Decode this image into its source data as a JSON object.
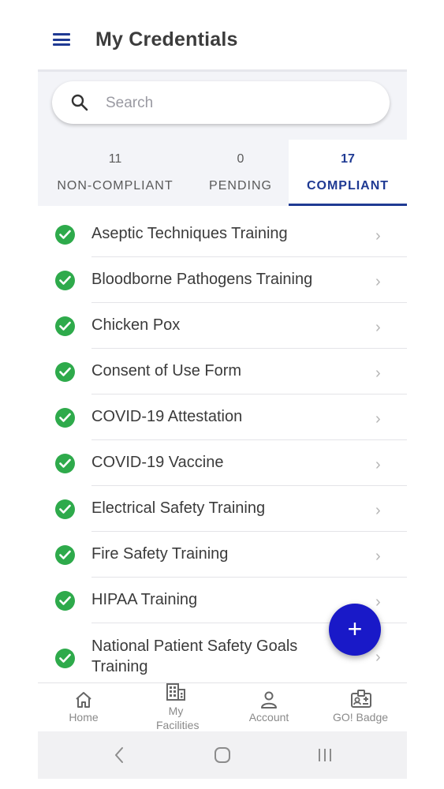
{
  "header": {
    "title": "My Credentials"
  },
  "search": {
    "placeholder": "Search"
  },
  "tabs": [
    {
      "count": "11",
      "label": "NON-COMPLIANT",
      "active": false
    },
    {
      "count": "0",
      "label": "PENDING",
      "active": false
    },
    {
      "count": "17",
      "label": "COMPLIANT",
      "active": true
    }
  ],
  "credentials": [
    "Aseptic Techniques Training",
    "Bloodborne Pathogens Training",
    "Chicken Pox",
    "Consent of Use Form",
    "COVID-19 Attestation",
    "COVID-19 Vaccine",
    "Electrical Safety Training",
    "Fire Safety Training",
    "HIPAA Training",
    "National Patient Safety Goals Training"
  ],
  "bottom_nav": {
    "home": "Home",
    "facilities": "My Facilities",
    "account": "Account",
    "badge": "GO! Badge"
  },
  "colors": {
    "accent": "#1f3a93",
    "status_ok": "#2eaa4b",
    "fab": "#1919c8"
  },
  "icons": [
    "menu-icon",
    "search-icon",
    "check-circle-icon",
    "chevron-right-icon",
    "plus-icon",
    "home-icon",
    "building-icon",
    "account-icon",
    "badge-icon",
    "back-icon",
    "home-circle-icon",
    "recents-icon"
  ]
}
